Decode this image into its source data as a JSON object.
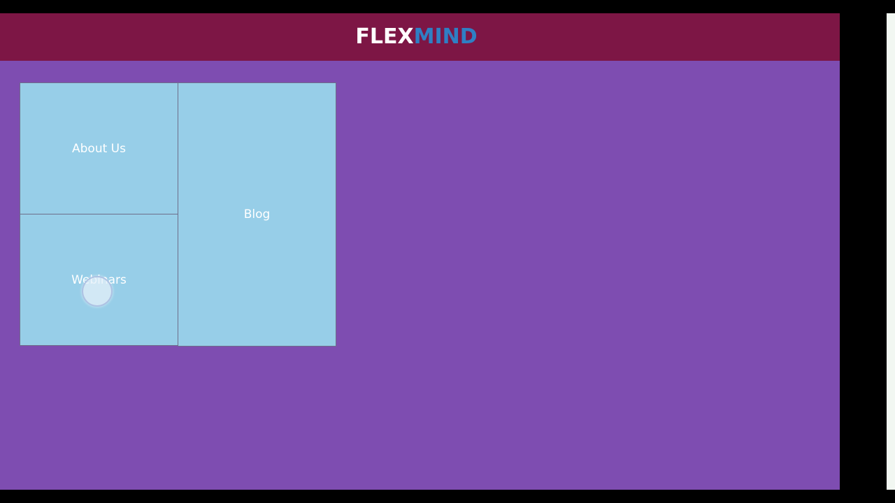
{
  "header": {
    "logo_part1": "FLEX",
    "logo_part2": "MIND"
  },
  "tiles": {
    "about_us": "About Us",
    "webinars": "Webinars",
    "blog": "Blog"
  },
  "colors": {
    "header_bg": "#7d1645",
    "page_bg": "#7e4db1",
    "tile_bg": "#97cee8",
    "logo_accent": "#2f7fc4"
  }
}
